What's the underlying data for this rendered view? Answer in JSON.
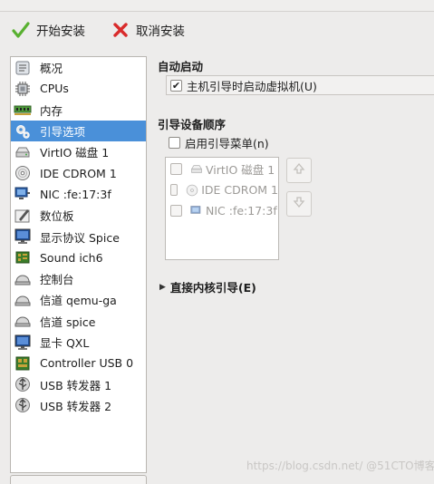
{
  "toolbar": {
    "start_label": "开始安装",
    "cancel_label": "取消安装"
  },
  "sidebar": {
    "items": [
      {
        "label": "概况",
        "icon": "overview-icon"
      },
      {
        "label": "CPUs",
        "icon": "cpu-icon"
      },
      {
        "label": "内存",
        "icon": "memory-icon"
      },
      {
        "label": "引导选项",
        "icon": "boot-options-icon",
        "selected": true
      },
      {
        "label": "VirtIO 磁盘 1",
        "icon": "disk-icon"
      },
      {
        "label": "IDE CDROM 1",
        "icon": "cdrom-icon"
      },
      {
        "label": "NIC :fe:17:3f",
        "icon": "nic-icon"
      },
      {
        "label": "数位板",
        "icon": "tablet-icon"
      },
      {
        "label": "显示协议 Spice",
        "icon": "display-icon"
      },
      {
        "label": "Sound ich6",
        "icon": "sound-icon"
      },
      {
        "label": "控制台",
        "icon": "console-icon"
      },
      {
        "label": "信道 qemu-ga",
        "icon": "channel-icon"
      },
      {
        "label": "信道 spice",
        "icon": "channel-icon"
      },
      {
        "label": "显卡 QXL",
        "icon": "video-card-icon"
      },
      {
        "label": "Controller USB 0",
        "icon": "usb-controller-icon"
      },
      {
        "label": "USB 转发器 1",
        "icon": "usb-redirector-icon"
      },
      {
        "label": "USB 转发器 2",
        "icon": "usb-redirector-icon"
      }
    ]
  },
  "autostart": {
    "title": "自动启动",
    "checkbox_label": "主机引导时启动虚拟机(U)",
    "checked": true
  },
  "boot_order": {
    "title": "引导设备顺序",
    "menu_checkbox_label": "启用引导菜单(n)",
    "menu_checked": false,
    "devices": [
      {
        "label": "VirtIO 磁盘 1",
        "icon": "disk-icon",
        "checked": false
      },
      {
        "label": "IDE CDROM 1",
        "icon": "cdrom-icon",
        "checked": false
      },
      {
        "label": "NIC :fe:17:3f",
        "icon": "nic-icon",
        "checked": false
      }
    ]
  },
  "direct_kernel": {
    "label": "直接内核引导(E)"
  },
  "watermark": "https://blog.csdn.net/ @51CTO博客",
  "colors": {
    "selection": "#4a90d9",
    "background": "#edeceb",
    "cancel_red": "#d92b2b",
    "start_green": "#58b030"
  }
}
